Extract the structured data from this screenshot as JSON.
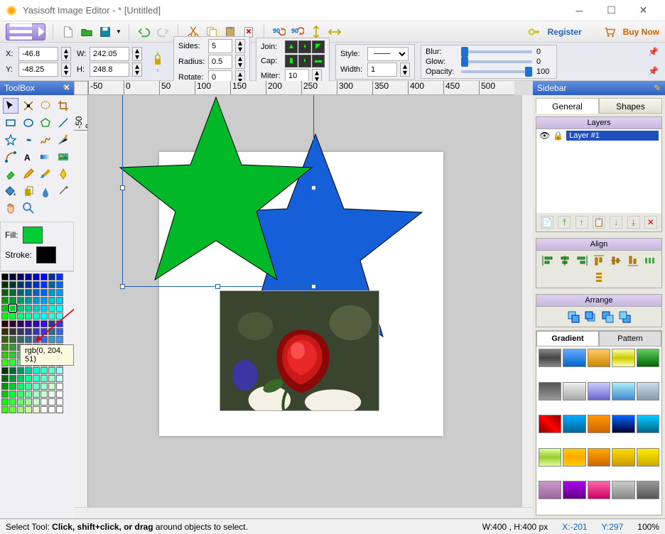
{
  "title": "Yasisoft Image Editor - * [Untitled]",
  "toolbar": {
    "register": "Register",
    "buynow": "Buy Now"
  },
  "coords": {
    "x_label": "X:",
    "x": "-46.8",
    "y_label": "Y:",
    "y": "-48.25",
    "w_label": "W:",
    "w": "242.05",
    "h_label": "H:",
    "h": "248.8"
  },
  "shape_props": {
    "sides_label": "Sides:",
    "sides": "5",
    "radius_label": "Radius:",
    "radius": "0.5",
    "rotate_label": "Rotate:",
    "rotate": "0",
    "join_label": "Join:",
    "cap_label": "Cap:",
    "miter_label": "Miter:",
    "miter": "10",
    "style_label": "Style:",
    "width_label": "Width:",
    "width": "1"
  },
  "effects": {
    "blur_label": "Blur:",
    "blur": "0",
    "glow_label": "Glow:",
    "glow": "0",
    "opacity_label": "Opacity:",
    "opacity": "100"
  },
  "toolbox_title": "ToolBox",
  "fill_label": "Fill:",
  "stroke_label": "Stroke:",
  "fill_color": "#00cc33",
  "stroke_color": "#000000",
  "color_tooltip": "rgb(0, 204, 51)",
  "sidebar_title": "Sidebar",
  "tabs": {
    "general": "General",
    "shapes": "Shapes"
  },
  "layers": {
    "header": "Layers",
    "items": [
      "Layer #1"
    ]
  },
  "align_header": "Align",
  "arrange_header": "Arrange",
  "subtabs": {
    "gradient": "Gradient",
    "pattern": "Pattern"
  },
  "status": {
    "tool": "Select Tool:",
    "hint": "Click, shift+click, or drag",
    "hint2": " around objects to select.",
    "wh": "W:400 , H:400 px",
    "x": "X:-201",
    "y": "Y:297",
    "zoom": "100%"
  },
  "palette_rows": [
    [
      "#000000",
      "#000033",
      "#000066",
      "#000099",
      "#0000cc",
      "#0000ff",
      "#003399",
      "#0033ff"
    ],
    [
      "#003300",
      "#003333",
      "#003366",
      "#003399",
      "#0033cc",
      "#0033ff",
      "#006699",
      "#0066ff"
    ],
    [
      "#006600",
      "#006633",
      "#006666",
      "#006699",
      "#0066cc",
      "#0066ff",
      "#0099cc",
      "#0099ff"
    ],
    [
      "#009900",
      "#009933",
      "#009966",
      "#009999",
      "#0099cc",
      "#0099ff",
      "#00cccc",
      "#00ccff"
    ],
    [
      "#00cc00",
      "#00cc33",
      "#00cc66",
      "#00cc99",
      "#00cccc",
      "#00ccff",
      "#00ffcc",
      "#00ffff"
    ],
    [
      "#00ff00",
      "#00ff33",
      "#00ff66",
      "#00ff99",
      "#00ffcc",
      "#00ffff",
      "#33ffcc",
      "#33ffff"
    ],
    [
      "#330000",
      "#330033",
      "#330066",
      "#330099",
      "#3300cc",
      "#3300ff",
      "#333399",
      "#3333ff"
    ],
    [
      "#333300",
      "#333333",
      "#333366",
      "#333399",
      "#3333cc",
      "#3333ff",
      "#336699",
      "#3366ff"
    ],
    [
      "#336600",
      "#336633",
      "#336666",
      "#336699",
      "#3366cc",
      "#3366ff",
      "#3399cc",
      "#3399ff"
    ],
    [
      "#339900",
      "#339933",
      "#339966",
      "#339999",
      "#3399cc",
      "#3399ff",
      "#33cccc",
      "#33ccff"
    ],
    [
      "#33cc00",
      "#33cc33",
      "#33cc66",
      "#33cc99",
      "#33cccc",
      "#33ccff",
      "#33ffcc",
      "#33ffff"
    ],
    [
      "#33ff00",
      "#33ff33",
      "#33ff66",
      "#33ff99",
      "#33ffcc",
      "#33ffff",
      "#66ffcc",
      "#66ffff"
    ],
    [
      "#003300",
      "#006633",
      "#009966",
      "#00cc99",
      "#00ffcc",
      "#33ffcc",
      "#66ffcc",
      "#99ffff"
    ],
    [
      "#006600",
      "#009933",
      "#00cc66",
      "#00ff99",
      "#33ffcc",
      "#66ffcc",
      "#99ffcc",
      "#ccffff"
    ],
    [
      "#009900",
      "#00cc33",
      "#00ff66",
      "#33ff99",
      "#66ffcc",
      "#99ffcc",
      "#ccffcc",
      "#ffffff"
    ],
    [
      "#00cc00",
      "#00ff33",
      "#33ff66",
      "#66ff99",
      "#99ffcc",
      "#ccffcc",
      "#eeffee",
      "#ffffff"
    ],
    [
      "#00ff00",
      "#33ff33",
      "#66ff66",
      "#99ff99",
      "#ccffcc",
      "#eeffee",
      "#ffffff",
      "#ffffff"
    ],
    [
      "#33ff00",
      "#66ff33",
      "#99ff66",
      "#ccff99",
      "#eeffcc",
      "#ffffff",
      "#ffffff",
      "#ffffff"
    ]
  ],
  "gradients": [
    "linear-gradient(#888,#444,#888)",
    "linear-gradient(#6af,#06c)",
    "linear-gradient(#fc6,#c80)",
    "linear-gradient(#ffa,#cc0,#ffa)",
    "linear-gradient(#6c6,#060)",
    "linear-gradient(#555,#999)",
    "linear-gradient(#eee,#aaa)",
    "linear-gradient(#ccf,#66c)",
    "linear-gradient(#aef,#48c)",
    "linear-gradient(#cde,#89a)",
    "linear-gradient(45deg,#800,#f00,#800)",
    "linear-gradient(#0af,#069)",
    "linear-gradient(#f90,#c60)",
    "linear-gradient(#06f,#003)",
    "linear-gradient(#0cf,#068)",
    "linear-gradient(#df9,#9c3,#df9)",
    "linear-gradient(#fc0,#fa0,#fc0)",
    "linear-gradient(#fa0,#c60)",
    "linear-gradient(#fd0,#c90)",
    "linear-gradient(#fe0,#ca0)",
    "linear-gradient(#c9c,#969)",
    "linear-gradient(#a0e,#608)",
    "linear-gradient(#f6a,#c06)",
    "linear-gradient(#ccc,#888)",
    "linear-gradient(#999,#555)"
  ]
}
